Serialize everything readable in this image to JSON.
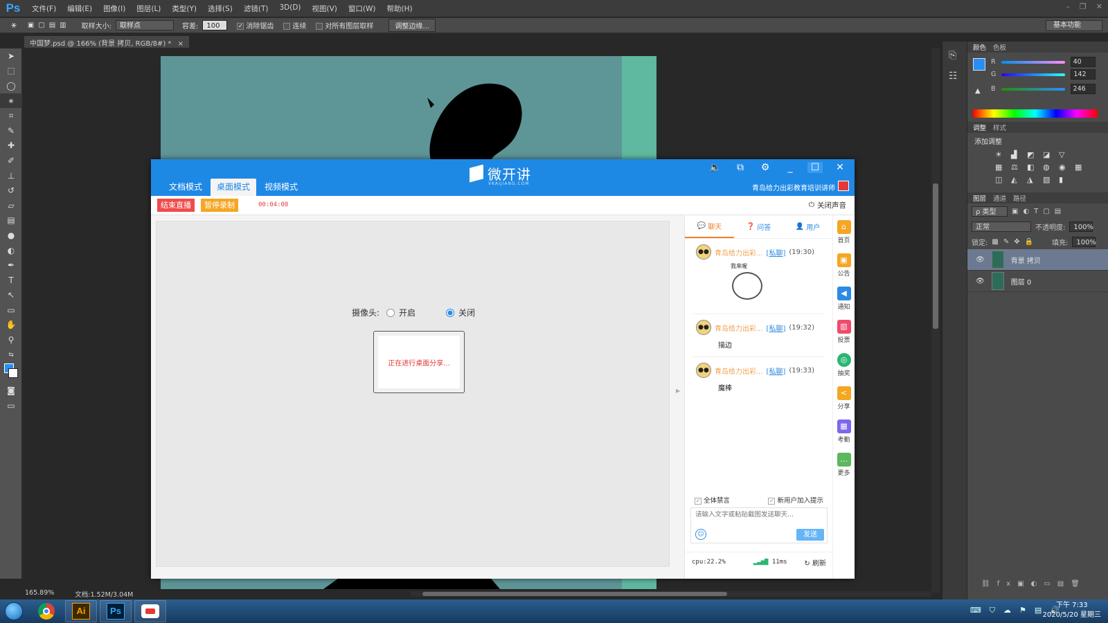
{
  "ps": {
    "logo": "Ps",
    "menu": [
      "文件(F)",
      "编辑(E)",
      "图像(I)",
      "图层(L)",
      "类型(Y)",
      "选择(S)",
      "滤镜(T)",
      "3D(D)",
      "视图(V)",
      "窗口(W)",
      "帮助(H)"
    ],
    "options": {
      "sample_size_label": "取样大小:",
      "sample_size_value": "取样点",
      "tolerance_label": "容差:",
      "tolerance_value": "100",
      "antialias_label": "消除锯齿",
      "contiguous_label": "连续",
      "all_layers_label": "对所有图层取样",
      "refine_edge_label": "调整边缘...",
      "workspace": "基本功能"
    },
    "doc_tab": "中国梦.psd @ 166% (背景 拷贝, RGB/8#) *",
    "doc_tab_close": "×",
    "status_zoom": "165.89%",
    "status_doc": "文档:1.52M/3.04M",
    "color_panel": {
      "tabs": [
        "颜色",
        "色板"
      ],
      "r_label": "R",
      "r_value": "40",
      "g_label": "G",
      "g_value": "142",
      "b_label": "B",
      "b_value": "246"
    },
    "adjust_panel": {
      "tabs": [
        "调整",
        "样式"
      ],
      "title": "添加调整"
    },
    "layers_panel": {
      "tabs": [
        "图层",
        "通道",
        "路径"
      ],
      "kind": "ρ 类型",
      "blend": "正常",
      "opacity_label": "不透明度:",
      "opacity_value": "100%",
      "lock_label": "锁定:",
      "fill_label": "填充:",
      "fill_value": "100%",
      "layers": [
        {
          "name": "背景 拷贝",
          "selected": true
        },
        {
          "name": "图层 0",
          "selected": false
        }
      ]
    }
  },
  "vk": {
    "brand": "微开讲",
    "brand_sub": "VKAIJIANG.COM",
    "tabs": [
      "文档模式",
      "桌面模式",
      "视频模式"
    ],
    "active_tab": 1,
    "host": "青岛给力出彩教育培训讲师",
    "end_live": "结束直播",
    "pause_record": "暂停录制",
    "timer": "00:04:08",
    "mute": "关闭声音",
    "camera_label": "摄像头:",
    "camera_on": "开启",
    "camera_off": "关闭",
    "sharing_text": "正在进行桌面分享...",
    "chat_tabs": [
      "聊天",
      "问答",
      "用户"
    ],
    "messages": [
      {
        "sender": "青岛给力出彩...",
        "private": "[私聊]",
        "time": "(19:30)",
        "text": "",
        "sticker_caption": "我来喔"
      },
      {
        "sender": "青岛给力出彩...",
        "private": "[私聊]",
        "time": "(19:32)",
        "text": "描边"
      },
      {
        "sender": "青岛给力出彩...",
        "private": "[私聊]",
        "time": "(19:33)",
        "text": "魔棒"
      }
    ],
    "mute_all": "全体禁言",
    "join_notice": "新用户加入提示",
    "input_placeholder": "请输入文字或粘贴截图发送聊天...",
    "send": "发送",
    "cpu": "cpu:22.2%",
    "latency": "11ms",
    "refresh": "刷新",
    "side_nav": [
      {
        "label": "首页",
        "color": "#f5a623",
        "glyph": "⌂"
      },
      {
        "label": "公告",
        "color": "#f5a623",
        "glyph": "▣"
      },
      {
        "label": "通知",
        "color": "#2b8ae6",
        "glyph": "◀"
      },
      {
        "label": "投票",
        "color": "#f04b6b",
        "glyph": "▥"
      },
      {
        "label": "抽奖",
        "color": "#2bb673",
        "glyph": "◎"
      },
      {
        "label": "分享",
        "color": "#f5a623",
        "glyph": "<"
      },
      {
        "label": "考勤",
        "color": "#7b68ee",
        "glyph": "▦"
      },
      {
        "label": "更多",
        "color": "#5cb85c",
        "glyph": "…"
      }
    ]
  },
  "taskbar": {
    "time": "下午 7:33",
    "date": "2020/5/20 星期三"
  }
}
